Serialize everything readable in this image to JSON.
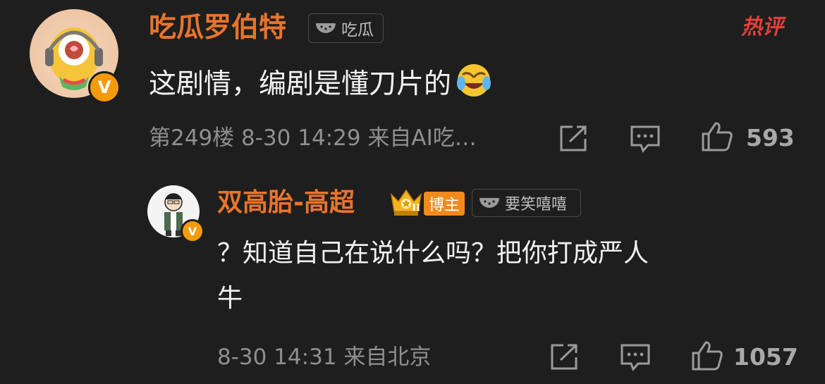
{
  "comment": {
    "user": "吃瓜罗伯特",
    "tag": "吃瓜",
    "hot_label": "热评",
    "text": "这剧情，编剧是懂刀片的",
    "meta": "第249楼 8-30 14:29 来自AI吃…",
    "likes": "593"
  },
  "reply": {
    "user": "双高胎-高超",
    "crown_level": "II",
    "blogger_badge": "博主",
    "tag": "要笑嘻嘻",
    "text_line1": "？知道自己在说什么吗？把你打成严人",
    "text_line2": "牛",
    "meta": "8-30 14:31 来自北京",
    "likes": "1057"
  },
  "colors": {
    "background": "#1e1e1e",
    "username": "#e8742c",
    "hot": "#e2403a",
    "verified": "#f59a0b"
  }
}
